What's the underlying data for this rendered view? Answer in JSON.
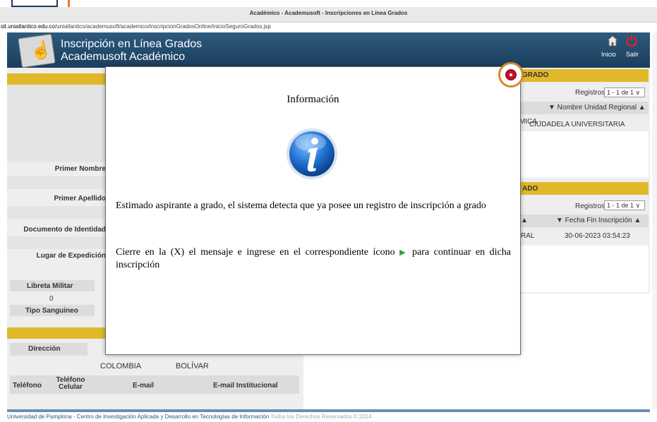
{
  "browser": {
    "window_title": "Académico - Academusoft - Inscripciones en Línea Grados",
    "url_domain": "sit.uniatlantico.edu.co",
    "url_path": "/uniatlantico/academusoft/academico/inscripcionGradosOnline/inicioSeguroGrados.jsp"
  },
  "header": {
    "title_line1": "Inscripción en Línea Grados",
    "title_line2": "Academusoft Académico",
    "home_label": "Inicio",
    "exit_label": "Salir",
    "home_icon": "home-icon",
    "exit_icon": "power-icon"
  },
  "left_panel": {
    "primer_nombre_label": "Primer Nombre",
    "primer_apellido_label": "Primer Apellido",
    "documento_label": "Documento de Identidad",
    "lugar_expedicion_label": "Lugar de Expedición",
    "libreta_militar_label": "Libreta Militar",
    "libreta_militar_value": "0",
    "tipo_sanguineo_label": "Tipo Sanguineo",
    "direccion_label": "Dirección",
    "pais_value": "COLOMBIA",
    "departamento_value": "BOLÍVAR",
    "telefono_label": "Teléfono",
    "telefono_celular_label": "Teléfono Celular",
    "email_label": "E-mail",
    "email_institucional_label": "E-mail Institucional"
  },
  "right_panel": {
    "section1_title": "GRADO",
    "section1_registros_label": "Registros",
    "section1_registros_value": "1 - 1 de 1",
    "section1_column": "▼ Nombre Unidad Regional ▲",
    "section1_cell_left": "MICA -",
    "section1_cell_right": "CIUDADELA UNIVERSITARIA",
    "section2_title": "ADO",
    "section2_registros_label": "Registros",
    "section2_registros_value": "1 - 1 de 1",
    "section2_column_left": "▲",
    "section2_column": "▼ Fecha Fin Inscripción ▲",
    "section2_cell_left": "RAL",
    "section2_cell_date": "30-06-2023 03:54:23"
  },
  "footer": {
    "text": "Universidad de Pamplona - Centro de Investigación Aplicada y Desarrollo en Tecnologías de Información",
    "rights": "Todos los Derechos Reservados © 2014"
  },
  "modal": {
    "title": "Información",
    "icon": "info-icon",
    "close_icon": "close-icon",
    "message1": "Estimado aspirante a grado, el sistema detecta que ya posee un registro de inscripción a grado",
    "message2_part1": "Cierre en la (X) el mensaje e ingrese en el correspondiente ícono",
    "message2_part2": "para continuar en dicha inscripción",
    "accent_close_color": "#d7892b",
    "info_icon_color": "#1f6fd1"
  }
}
